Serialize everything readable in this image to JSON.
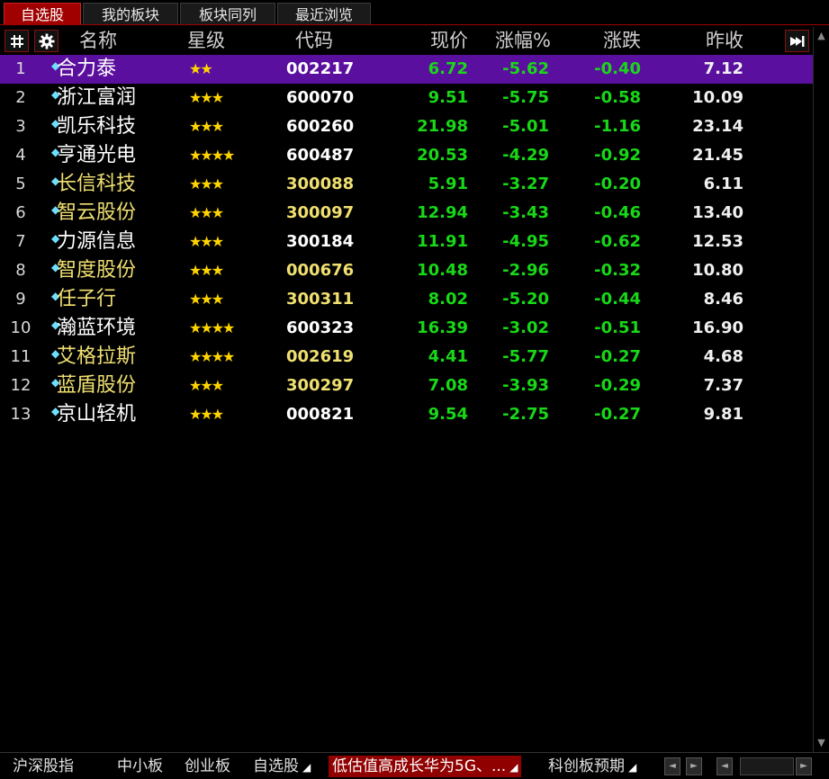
{
  "top_tabs": [
    "自选股",
    "我的板块",
    "板块同列",
    "最近浏览"
  ],
  "header": {
    "name": "名称",
    "stars": "星级",
    "code": "代码",
    "price": "现价",
    "pct": "涨幅%",
    "change": "涨跌",
    "prev_close": "昨收"
  },
  "colors": {
    "accent_red": "#a00000",
    "selected_row": "#5b0f9e",
    "down_green": "#18d818",
    "code_yellow": "#f0e070",
    "star": "#ffd400"
  },
  "rows": [
    {
      "idx": "1",
      "name": "合力泰",
      "stars": "★★",
      "code": "002217",
      "price": "6.72",
      "pct": "-5.62",
      "change": "-0.40",
      "prev": "7.12",
      "name_color": "#ffffff",
      "code_color": "#ffffff",
      "selected": true
    },
    {
      "idx": "2",
      "name": "浙江富润",
      "stars": "★★★",
      "code": "600070",
      "price": "9.51",
      "pct": "-5.75",
      "change": "-0.58",
      "prev": "10.09",
      "name_color": "#ffffff",
      "code_color": "#ffffff"
    },
    {
      "idx": "3",
      "name": "凯乐科技",
      "stars": "★★★",
      "code": "600260",
      "price": "21.98",
      "pct": "-5.01",
      "change": "-1.16",
      "prev": "23.14",
      "name_color": "#ffffff",
      "code_color": "#ffffff"
    },
    {
      "idx": "4",
      "name": "亨通光电",
      "stars": "★★★★",
      "code": "600487",
      "price": "20.53",
      "pct": "-4.29",
      "change": "-0.92",
      "prev": "21.45",
      "name_color": "#ffffff",
      "code_color": "#ffffff"
    },
    {
      "idx": "5",
      "name": "长信科技",
      "stars": "★★★",
      "code": "300088",
      "price": "5.91",
      "pct": "-3.27",
      "change": "-0.20",
      "prev": "6.11",
      "name_color": "#f0e070",
      "code_color": "#f0e070"
    },
    {
      "idx": "6",
      "name": "智云股份",
      "stars": "★★★",
      "code": "300097",
      "price": "12.94",
      "pct": "-3.43",
      "change": "-0.46",
      "prev": "13.40",
      "name_color": "#f0e070",
      "code_color": "#f0e070"
    },
    {
      "idx": "7",
      "name": "力源信息",
      "stars": "★★★",
      "code": "300184",
      "price": "11.91",
      "pct": "-4.95",
      "change": "-0.62",
      "prev": "12.53",
      "name_color": "#ffffff",
      "code_color": "#ffffff"
    },
    {
      "idx": "8",
      "name": "智度股份",
      "stars": "★★★",
      "code": "000676",
      "price": "10.48",
      "pct": "-2.96",
      "change": "-0.32",
      "prev": "10.80",
      "name_color": "#f0e070",
      "code_color": "#f0e070"
    },
    {
      "idx": "9",
      "name": "任子行",
      "stars": "★★★",
      "code": "300311",
      "price": "8.02",
      "pct": "-5.20",
      "change": "-0.44",
      "prev": "8.46",
      "name_color": "#f0e070",
      "code_color": "#f0e070"
    },
    {
      "idx": "10",
      "name": "瀚蓝环境",
      "stars": "★★★★",
      "code": "600323",
      "price": "16.39",
      "pct": "-3.02",
      "change": "-0.51",
      "prev": "16.90",
      "name_color": "#ffffff",
      "code_color": "#ffffff"
    },
    {
      "idx": "11",
      "name": "艾格拉斯",
      "stars": "★★★★",
      "code": "002619",
      "price": "4.41",
      "pct": "-5.77",
      "change": "-0.27",
      "prev": "4.68",
      "name_color": "#f0e070",
      "code_color": "#f0e070"
    },
    {
      "idx": "12",
      "name": "蓝盾股份",
      "stars": "★★★",
      "code": "300297",
      "price": "7.08",
      "pct": "-3.93",
      "change": "-0.29",
      "prev": "7.37",
      "name_color": "#f0e070",
      "code_color": "#f0e070"
    },
    {
      "idx": "13",
      "name": "京山轻机",
      "stars": "★★★",
      "code": "000821",
      "price": "9.54",
      "pct": "-2.75",
      "change": "-0.27",
      "prev": "9.81",
      "name_color": "#ffffff",
      "code_color": "#ffffff"
    }
  ],
  "bottom_tabs": [
    {
      "label": "沪深股指",
      "arrow": false
    },
    {
      "label": "中小板",
      "arrow": false
    },
    {
      "label": "创业板",
      "arrow": false
    },
    {
      "label": "自选股",
      "arrow": true
    },
    {
      "label": "低估值高成长华为5G、...",
      "arrow": true,
      "active": true
    },
    {
      "label": "科创板预期",
      "arrow": true
    }
  ]
}
